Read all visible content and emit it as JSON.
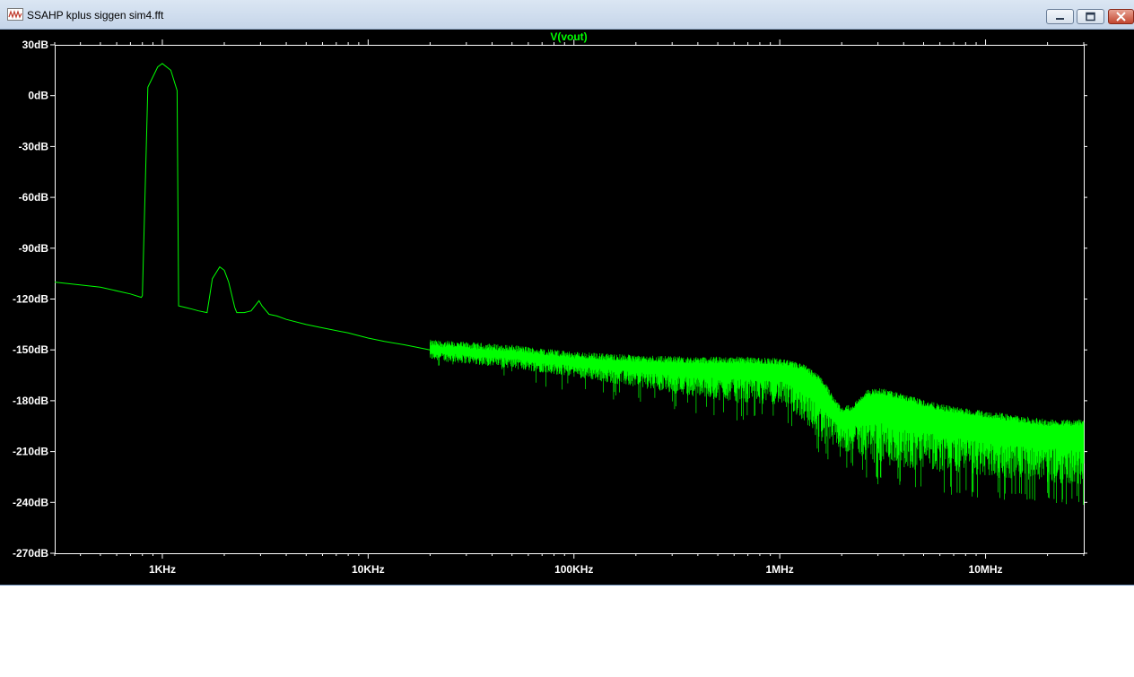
{
  "window": {
    "title": "SSAHP kplus siggen sim4.fft"
  },
  "colors": {
    "background": "#000000",
    "trace": "#00ff00",
    "axes": "#ffffff",
    "titlebar": "#d5e1ef"
  },
  "icons": [
    "waveform-app-icon",
    "minimize-icon",
    "maximize-icon",
    "close-icon"
  ],
  "chart_data": {
    "type": "line",
    "title": "V(vout)",
    "xlabel": "",
    "ylabel": "",
    "x_scale": "log",
    "xlim_hz": [
      300,
      30000000
    ],
    "ylim_db": [
      -270,
      30
    ],
    "grid": false,
    "x_ticks": [
      {
        "value": 1000,
        "label": "1KHz"
      },
      {
        "value": 10000,
        "label": "10KHz"
      },
      {
        "value": 100000,
        "label": "100KHz"
      },
      {
        "value": 1000000,
        "label": "1MHz"
      },
      {
        "value": 10000000,
        "label": "10MHz"
      }
    ],
    "y_ticks": [
      {
        "value": 30,
        "label": "30dB"
      },
      {
        "value": 0,
        "label": "0dB"
      },
      {
        "value": -30,
        "label": "-30dB"
      },
      {
        "value": -60,
        "label": "-60dB"
      },
      {
        "value": -90,
        "label": "-90dB"
      },
      {
        "value": -120,
        "label": "-120dB"
      },
      {
        "value": -150,
        "label": "-150dB"
      },
      {
        "value": -180,
        "label": "-180dB"
      },
      {
        "value": -210,
        "label": "-210dB"
      },
      {
        "value": -240,
        "label": "-240dB"
      },
      {
        "value": -270,
        "label": "-270dB"
      }
    ],
    "series": [
      {
        "name": "V(vout)",
        "x": [
          300,
          500,
          700,
          790,
          800,
          850,
          950,
          1000,
          1100,
          1180,
          1200,
          1300,
          1400,
          1500,
          1650,
          1700,
          1750,
          1900,
          2000,
          2100,
          2250,
          2300,
          2500,
          2700,
          2950,
          3050,
          3300,
          3600,
          4000,
          5000,
          6000,
          8000,
          10000,
          12000,
          15000,
          20000
        ],
        "y": [
          -110,
          -113,
          -117,
          -119,
          -118,
          5,
          17,
          19,
          15,
          3,
          -124,
          -125,
          -126,
          -127,
          -128,
          -118,
          -108,
          -101,
          -103,
          -110,
          -125,
          -128,
          -128,
          -127,
          -121,
          -124,
          -129,
          -130,
          -132,
          -135,
          -137,
          -140,
          -143,
          -145,
          -147,
          -150
        ]
      }
    ],
    "noise_envelope": {
      "x": [
        20000,
        50000,
        100000,
        200000,
        400000,
        700000,
        1000000,
        1300000,
        1600000,
        2000000,
        2300000,
        2600000,
        3000000,
        4000000,
        6000000,
        10000000,
        20000000,
        30000000
      ],
      "upper": [
        -148,
        -151,
        -155,
        -157,
        -158,
        -158,
        -159,
        -162,
        -170,
        -188,
        -185,
        -178,
        -176,
        -180,
        -186,
        -190,
        -195,
        -195
      ],
      "lower": [
        -156,
        -161,
        -166,
        -172,
        -178,
        -182,
        -182,
        -192,
        -205,
        -210,
        -210,
        -215,
        -218,
        -220,
        -222,
        -225,
        -228,
        -230
      ],
      "spike_floor": [
        -160,
        -168,
        -175,
        -182,
        -188,
        -193,
        -195,
        -205,
        -215,
        -218,
        -222,
        -228,
        -230,
        -232,
        -235,
        -238,
        -240,
        -242
      ]
    }
  }
}
